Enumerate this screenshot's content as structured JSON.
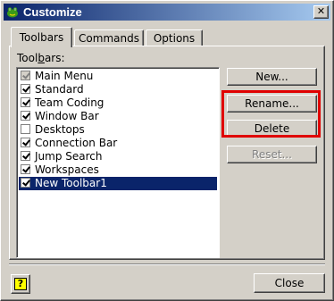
{
  "window": {
    "title": "Customize",
    "close_glyph": "✕"
  },
  "tabs": [
    {
      "label": "Toolbars",
      "active": true
    },
    {
      "label": "Commands",
      "active": false
    },
    {
      "label": "Options",
      "active": false
    }
  ],
  "toolbars_label_pre": "Tool",
  "toolbars_label_key": "b",
  "toolbars_label_post": "ars:",
  "toolbars": [
    {
      "label": "Main Menu",
      "checked": true,
      "disabled": true,
      "selected": false
    },
    {
      "label": "Standard",
      "checked": true,
      "disabled": false,
      "selected": false
    },
    {
      "label": "Team Coding",
      "checked": true,
      "disabled": false,
      "selected": false
    },
    {
      "label": "Window Bar",
      "checked": true,
      "disabled": false,
      "selected": false
    },
    {
      "label": "Desktops",
      "checked": false,
      "disabled": false,
      "selected": false
    },
    {
      "label": "Connection Bar",
      "checked": true,
      "disabled": false,
      "selected": false
    },
    {
      "label": "Jump Search",
      "checked": true,
      "disabled": false,
      "selected": false
    },
    {
      "label": "Workspaces",
      "checked": true,
      "disabled": false,
      "selected": false
    },
    {
      "label": "New Toolbar1",
      "checked": true,
      "disabled": false,
      "selected": true
    }
  ],
  "buttons": {
    "new": "New...",
    "rename": "Rename...",
    "delete": "Delete",
    "reset": "Reset...",
    "close": "Close"
  },
  "help_glyph": "?",
  "colors": {
    "selection": "#0a246a",
    "highlight_box": "#e00000"
  }
}
